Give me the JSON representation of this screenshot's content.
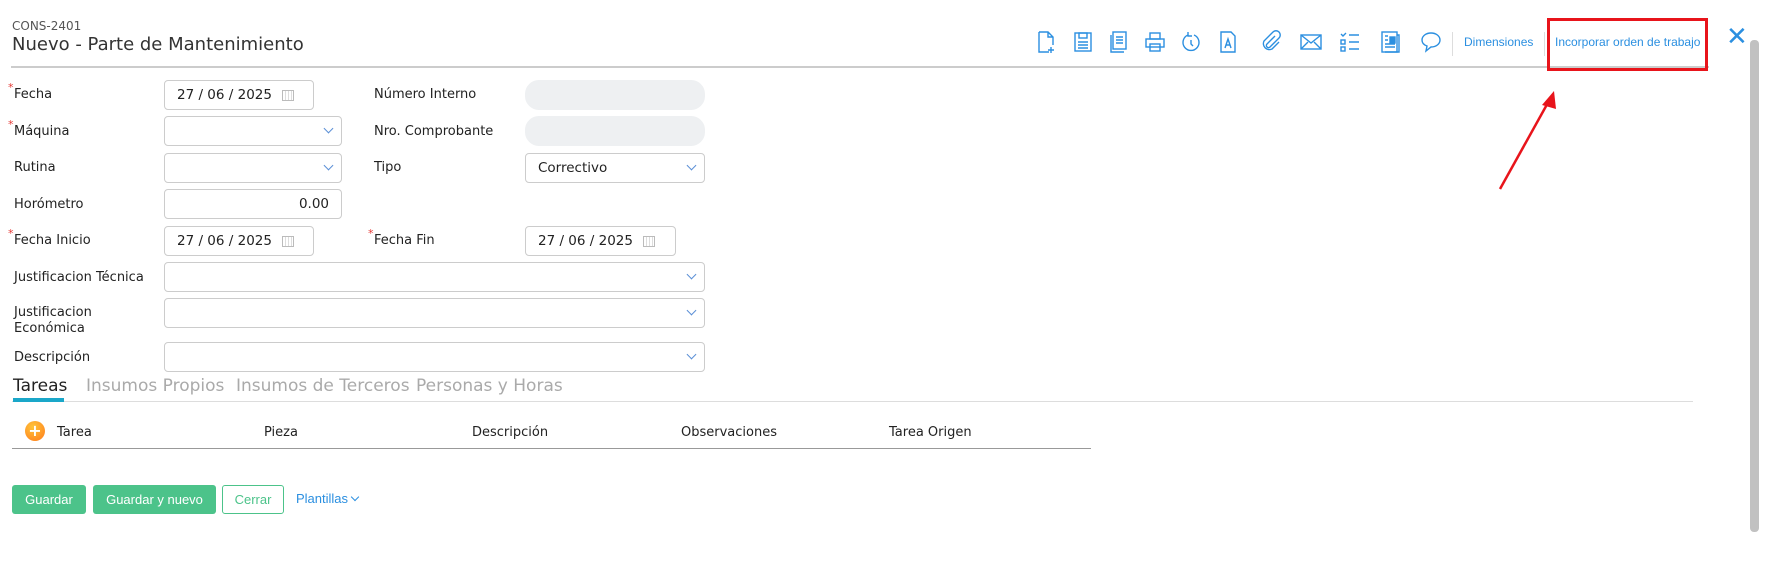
{
  "header": {
    "code": "CONS-2401",
    "title": "Nuevo - Parte de Mantenimiento"
  },
  "toolbar": {
    "icons": [
      "new-document-icon",
      "save-icon",
      "copy-icon",
      "print-icon",
      "history-icon",
      "pdf-text-icon",
      "attachment-icon",
      "email-icon",
      "checklist-icon",
      "report-icon",
      "comment-icon"
    ],
    "dimensiones": "Dimensiones",
    "incorporar": "Incorporar orden de trabajo",
    "close": "✕",
    "highlight_color": "#e8141b"
  },
  "form": {
    "fecha": {
      "label": "Fecha",
      "value": "27 / 06 / 2025"
    },
    "maquina": {
      "label": "Máquina",
      "value": ""
    },
    "rutina": {
      "label": "Rutina",
      "value": ""
    },
    "horometro": {
      "label": "Horómetro",
      "value": "0.00"
    },
    "fecha_inicio": {
      "label": "Fecha Inicio",
      "value": "27 / 06 / 2025"
    },
    "numero_interno": {
      "label": "Número Interno",
      "value": ""
    },
    "nro_comprobante": {
      "label": "Nro. Comprobante",
      "value": ""
    },
    "tipo": {
      "label": "Tipo",
      "value": "Correctivo"
    },
    "fecha_fin": {
      "label": "Fecha Fin",
      "value": "27 / 06 / 2025"
    },
    "just_tecnica": {
      "label": "Justificacion Técnica",
      "value": ""
    },
    "just_economica": {
      "label": "Justificacion Económica",
      "value": ""
    },
    "descripcion": {
      "label": "Descripción",
      "value": ""
    }
  },
  "tabs": [
    "Tareas",
    "Insumos Propios",
    "Insumos de Terceros",
    "Personas y Horas"
  ],
  "table": {
    "columns": [
      "Tarea",
      "Pieza",
      "Descripción",
      "Observaciones",
      "Tarea Origen"
    ],
    "rows": []
  },
  "footer": {
    "guardar": "Guardar",
    "guardar_nuevo": "Guardar y nuevo",
    "cerrar": "Cerrar",
    "plantillas": "Plantillas"
  }
}
